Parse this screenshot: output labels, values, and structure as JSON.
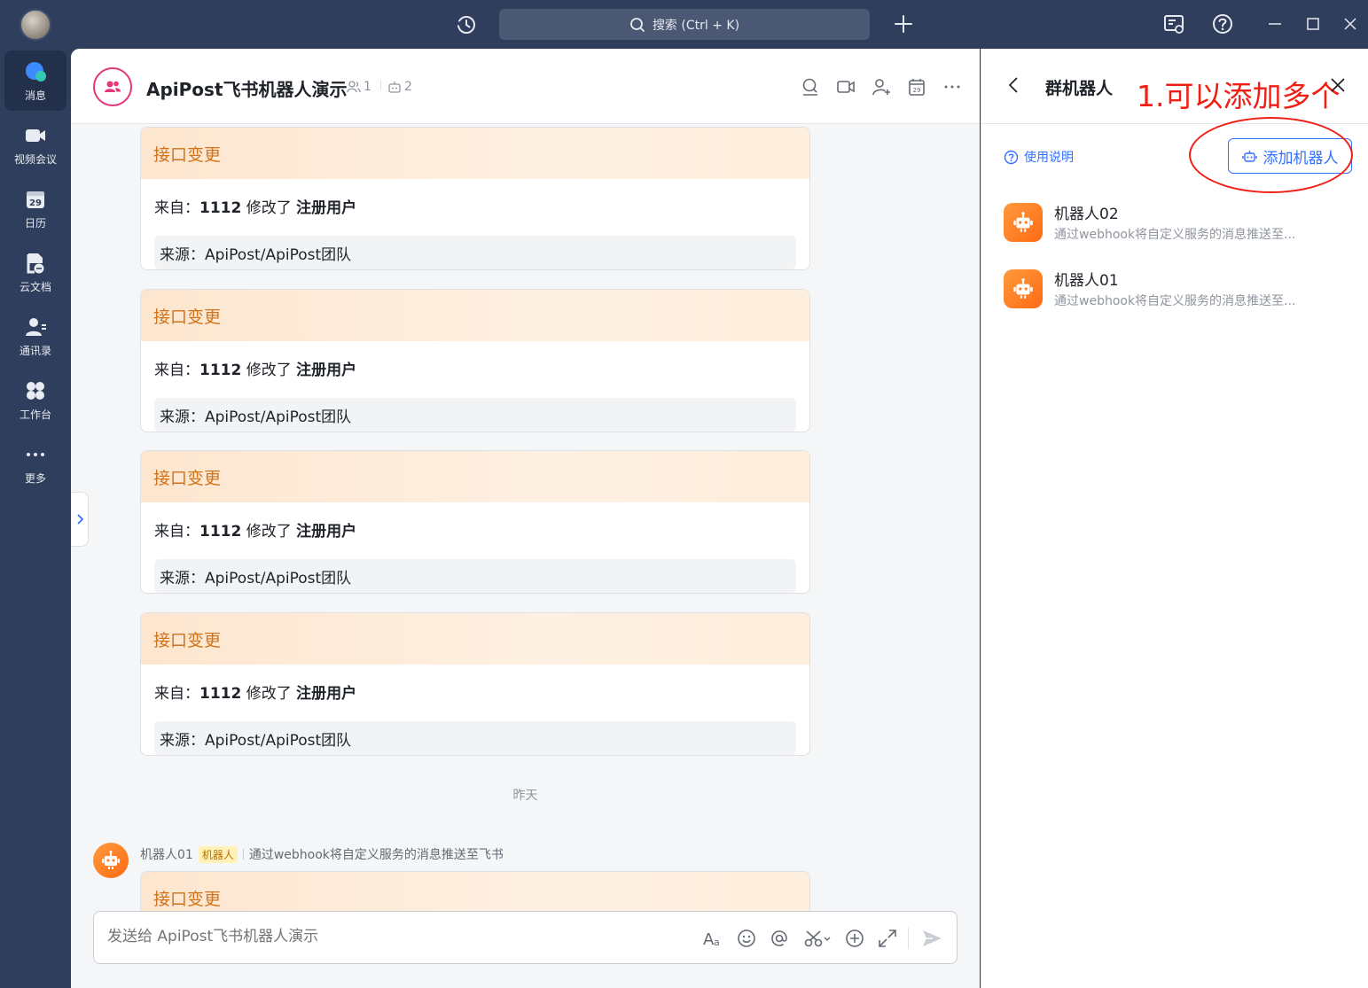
{
  "titlebar": {
    "search_label": "搜索 (Ctrl + K)"
  },
  "nav": {
    "items": [
      {
        "label": "消息",
        "icon": "chat-bubble-icon"
      },
      {
        "label": "视频会议",
        "icon": "video-camera-icon"
      },
      {
        "label": "日历",
        "icon": "calendar-icon",
        "day": "29"
      },
      {
        "label": "云文档",
        "icon": "cloud-doc-icon"
      },
      {
        "label": "通讯录",
        "icon": "contacts-icon"
      },
      {
        "label": "工作台",
        "icon": "workspace-grid-icon"
      },
      {
        "label": "更多",
        "icon": "more-dots-icon"
      }
    ]
  },
  "chat": {
    "title": "ApiPost飞书机器人演示",
    "member_count": "1",
    "bot_count": "2",
    "cards": [
      {
        "title": "接口变更",
        "from_prefix": "来自：",
        "user": "1112",
        "action": " 修改了 ",
        "target": "注册用户",
        "source": "来源：ApiPost/ApiPost团队"
      },
      {
        "title": "接口变更",
        "from_prefix": "来自：",
        "user": "1112",
        "action": " 修改了 ",
        "target": "注册用户",
        "source": "来源：ApiPost/ApiPost团队"
      },
      {
        "title": "接口变更",
        "from_prefix": "来自：",
        "user": "1112",
        "action": " 修改了 ",
        "target": "注册用户",
        "source": "来源：ApiPost/ApiPost团队"
      },
      {
        "title": "接口变更",
        "from_prefix": "来自：",
        "user": "1112",
        "action": " 修改了 ",
        "target": "注册用户",
        "source": "来源：ApiPost/ApiPost团队"
      }
    ],
    "day_separator": "昨天",
    "last_sender": {
      "name": "机器人01",
      "tag": "机器人",
      "desc": "通过webhook将自定义服务的消息推送至飞书"
    },
    "last_card_title": "接口变更",
    "composer_placeholder": "发送给 ApiPost飞书机器人演示"
  },
  "panel": {
    "title": "群机器人",
    "annotation": "1.可以添加多个",
    "help_label": "使用说明",
    "add_button": "添加机器人",
    "robots": [
      {
        "name": "机器人02",
        "desc": "通过webhook将自定义服务的消息推送至..."
      },
      {
        "name": "机器人01",
        "desc": "通过webhook将自定义服务的消息推送至..."
      }
    ]
  },
  "colors": {
    "nav_bg": "#2f3e5c",
    "accent_blue": "#3370ff",
    "card_title_orange": "#d0731a",
    "annotation_red": "#f01e14",
    "robot_orange": "#ff7a1a"
  }
}
